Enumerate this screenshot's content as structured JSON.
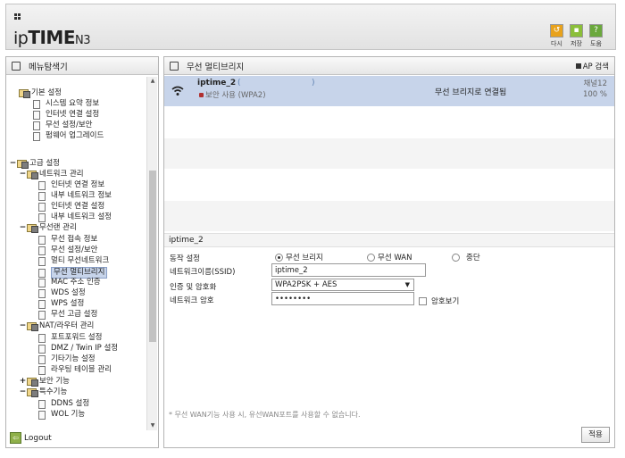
{
  "header": {
    "brand_prefix": "ip",
    "brand_bold": "TIME",
    "brand_model": "N3",
    "buttons": [
      {
        "label": "다시",
        "icon": "reset-icon",
        "color": "#e8a21c"
      },
      {
        "label": "저장",
        "icon": "save-icon",
        "color": "#8bbf3a"
      },
      {
        "label": "도움",
        "icon": "help-icon",
        "color": "#6aa83c"
      }
    ]
  },
  "sidebar": {
    "title": "메뉴탐색기",
    "logout": "Logout",
    "tree": {
      "basic": {
        "label": "기본 설정",
        "items": [
          "시스템 요약 정보",
          "인터넷 연결 설정",
          "무선 설정/보안",
          "펌웨어 업그레이드"
        ]
      },
      "advanced": {
        "label": "고급 설정",
        "network": {
          "label": "네트워크 관리",
          "items": [
            "인터넷 연결 정보",
            "내부 네트워크 정보",
            "인터넷 연결 설정",
            "내부 네트워크 설정"
          ]
        },
        "wireless": {
          "label": "무선랜 관리",
          "items": [
            "무선 접속 정보",
            "무선 설정/보안",
            "멀티 무선네트워크",
            "무선 멀티브리지",
            "MAC 주소 인증",
            "WDS 설정",
            "WPS 설정",
            "무선 고급 설정"
          ]
        },
        "nat": {
          "label": "NAT/라우터 관리",
          "items": [
            "포트포워드 설정",
            "DMZ / Twin IP 설정",
            "기타기능 설정",
            "라우팅 테이블 관리"
          ]
        },
        "security": {
          "label": "보안 기능"
        },
        "special": {
          "label": "특수기능",
          "items": [
            "DDNS 설정",
            "WOL 기능"
          ]
        }
      }
    }
  },
  "main": {
    "title": "무선 멀티브리지",
    "ap_search": "AP 검색",
    "ap_list": [
      {
        "ssid": "iptime_2",
        "paren_open": "(",
        "paren_close": ")",
        "security": "보안 사용 (WPA2)",
        "status": "무선 브리지로 연결됨",
        "channel": "채널12",
        "signal": "100 %"
      }
    ],
    "section_title": "iptime_2",
    "form": {
      "mode_label": "동작 설정",
      "mode_options": [
        "무선 브리지",
        "무선 WAN",
        "중단"
      ],
      "mode_selected": "무선 브리지",
      "ssid_label": "네트워크이름(SSID)",
      "ssid_value": "iptime_2",
      "auth_label": "인증 및 암호화",
      "auth_value": "WPA2PSK + AES",
      "key_label": "네트워크 암호",
      "key_value": "••••••••",
      "show_key_label": "암호보기",
      "show_key_checked": false
    },
    "footnote": "* 무선 WAN기능 사용 시, 유선WAN포트를 사용할 수 없습니다.",
    "apply_label": "적용"
  }
}
